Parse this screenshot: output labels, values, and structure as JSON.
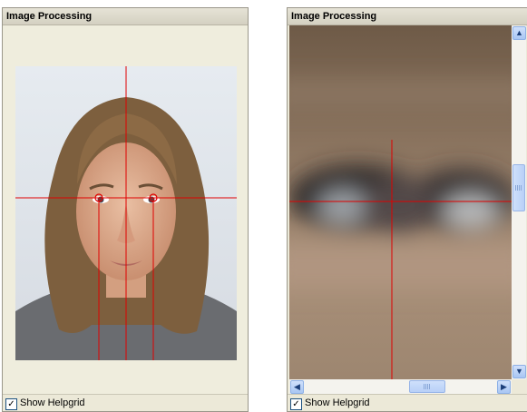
{
  "left_panel": {
    "title": "Image Processing",
    "helpgrid_label": "Show Helpgrid",
    "helpgrid_checked": true
  },
  "right_panel": {
    "title": "Image Processing",
    "helpgrid_label": "Show Helpgrid",
    "helpgrid_checked": true
  },
  "icons": {
    "scroll_up": "scroll-up-icon",
    "scroll_down": "scroll-down-icon",
    "scroll_left": "scroll-left-icon",
    "scroll_right": "scroll-right-icon"
  },
  "colors": {
    "helpgrid_line": "#e00000",
    "panel_bg": "#ece9d8",
    "scroll_button": "#b8d0f7"
  }
}
